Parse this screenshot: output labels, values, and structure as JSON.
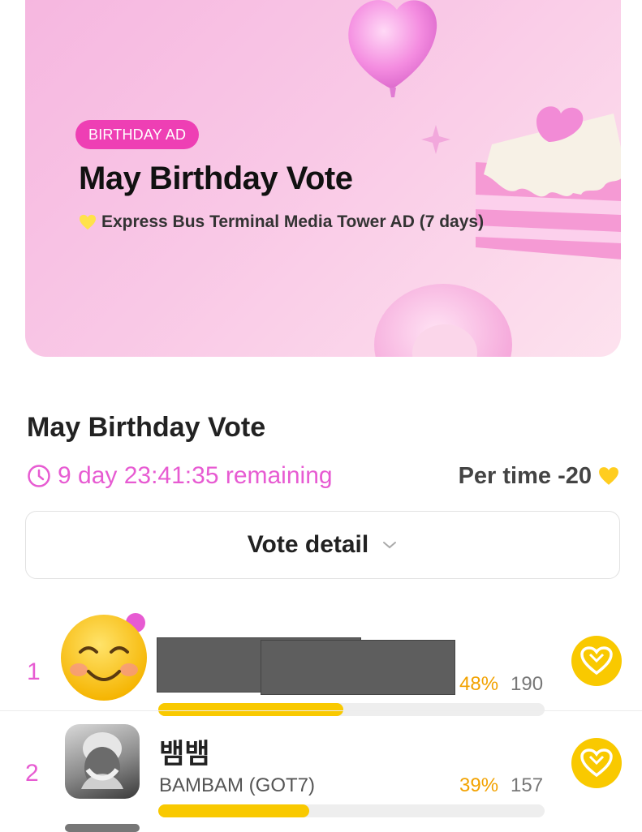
{
  "banner": {
    "badge": "BIRTHDAY AD",
    "title": "May Birthday Vote",
    "subtitle": "Express Bus Terminal Media Tower AD (7 days)",
    "colors": {
      "badge": "#ee3fb4",
      "heart": "#ffe24a"
    }
  },
  "section": {
    "title": "May Birthday Vote",
    "remaining": "9 day 23:41:35 remaining",
    "per_time": "Per time -20",
    "vote_detail": "Vote detail"
  },
  "icons": {
    "clock": "clock-icon",
    "heart": "heart-icon",
    "chevron": "chevron-down-icon",
    "vote": "vote-heart-icon"
  },
  "entries": [
    {
      "rank": "1",
      "name_kr": "",
      "name_en": "",
      "percent": "48%",
      "votes": "190",
      "progress": 0.48
    },
    {
      "rank": "2",
      "name_kr": "뱀뱀",
      "name_en": "BAMBAM (GOT7)",
      "percent": "39%",
      "votes": "157",
      "progress": 0.39
    }
  ],
  "colors": {
    "accent": "#e75bd2",
    "gold": "#f9c900",
    "percent": "#f2a200"
  }
}
